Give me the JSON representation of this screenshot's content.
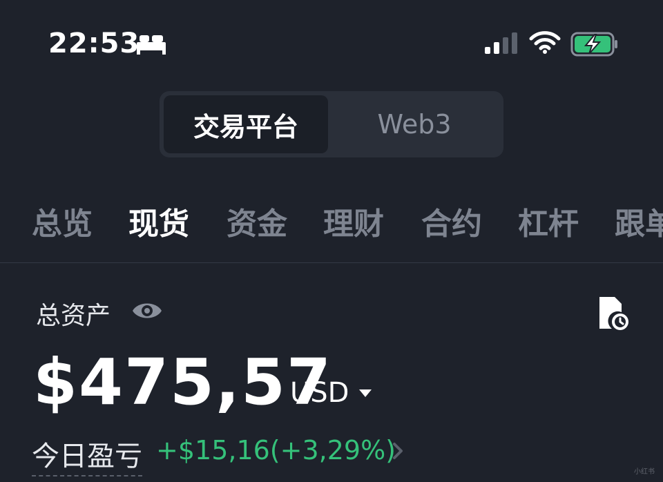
{
  "status_bar": {
    "time": "22:53",
    "icons": [
      "bed-icon",
      "cellular-signal-icon",
      "wifi-icon",
      "battery-charging-icon"
    ],
    "battery_color": "#35c17a"
  },
  "segment": {
    "active": "交易平台",
    "inactive": "Web3"
  },
  "tabs": [
    "总览",
    "现货",
    "资金",
    "理财",
    "合约",
    "杠杆",
    "跟单"
  ],
  "active_tab": "现货",
  "assets": {
    "label": "总资产",
    "balance": "$475,57",
    "currency": "USD",
    "pnl_label": "今日盈亏",
    "pnl_value": "+$15,16(+3,29%)"
  },
  "colors": {
    "background": "#1e222b",
    "positive": "#35c17a",
    "muted": "#7e8490"
  },
  "watermark": "小红书"
}
